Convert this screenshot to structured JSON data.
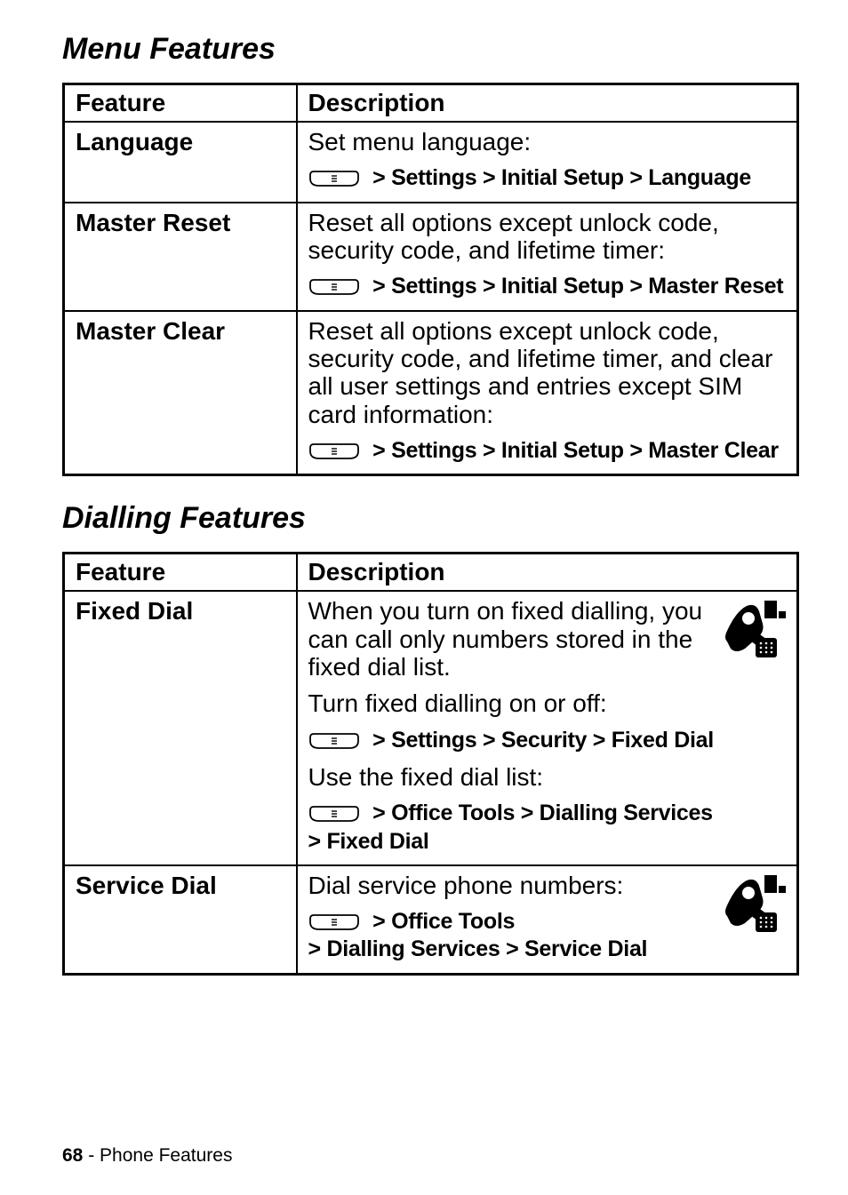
{
  "sections": {
    "menu_features": {
      "title": "Menu Features",
      "header_feature": "Feature",
      "header_desc": "Description",
      "rows": {
        "language": {
          "feature": "Language",
          "desc1": "Set menu language:",
          "path": " > Settings > Initial Setup > Language"
        },
        "master_reset": {
          "feature": "Master Reset",
          "desc1": "Reset all options except unlock code, security code, and lifetime timer:",
          "path": " > Settings > Initial Setup > Master Reset"
        },
        "master_clear": {
          "feature": "Master Clear",
          "desc1": "Reset all options except unlock code, security code, and lifetime timer, and clear all user settings and entries except SIM card information:",
          "path": " > Settings > Initial Setup > Master Clear"
        }
      }
    },
    "dialling_features": {
      "title": "Dialling Features",
      "header_feature": "Feature",
      "header_desc": "Description",
      "rows": {
        "fixed_dial": {
          "feature": "Fixed Dial",
          "desc1": "When you turn on fixed dialling, you can call only numbers stored in the fixed dial list.",
          "desc2": "Turn fixed dialling on or off:",
          "path1": " > Settings > Security > Fixed Dial",
          "desc3": "Use the fixed dial list:",
          "path2_line1": " > Office Tools > Dialling Services",
          "path2_line2": "> Fixed Dial"
        },
        "service_dial": {
          "feature": "Service Dial",
          "desc1": "Dial service phone numbers:",
          "path_line1": " > Office Tools",
          "path_line2": "> Dialling Services > Service Dial"
        }
      }
    }
  },
  "footer": {
    "page_num": "68",
    "sep": " - ",
    "section": "Phone Features"
  }
}
